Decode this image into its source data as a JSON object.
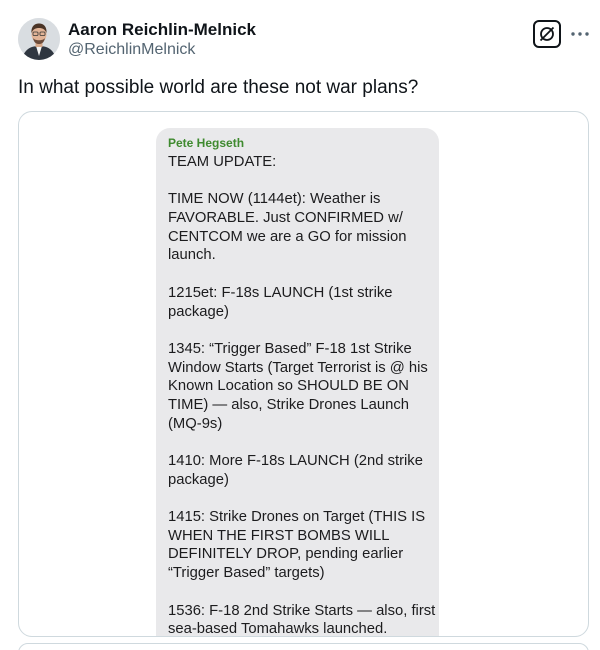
{
  "author": {
    "name": "Aaron Reichlin-Melnick",
    "handle": "@ReichlinMelnick"
  },
  "icons": {
    "grok": "grok-icon",
    "more": "more-horizontal-icon",
    "avatar": "profile-photo"
  },
  "tweet": {
    "text": "In what possible world are these not war plans?"
  },
  "message": {
    "sender": "Pete Hegseth",
    "lines": [
      "TEAM UPDATE:",
      "",
      "TIME NOW (1144et): Weather is",
      "FAVORABLE. Just CONFIRMED w/",
      "CENTCOM we are a GO for mission",
      "launch.",
      "",
      "1215et: F-18s LAUNCH (1st strike",
      "package)",
      "",
      "1345: “Trigger Based” F-18 1st Strike",
      "Window Starts (Target Terrorist is @ his",
      "Known Location so SHOULD BE ON",
      "TIME) — also, Strike Drones Launch",
      "(MQ-9s)",
      "",
      "1410: More F-18s LAUNCH (2nd strike",
      "package)",
      "",
      "1415: Strike Drones on Target (THIS IS",
      "WHEN THE FIRST BOMBS WILL",
      "DEFINITELY DROP, pending earlier",
      "“Trigger Based” targets)",
      "",
      "1536: F-18 2nd Strike Starts — also, first",
      "sea-based Tomahawks launched."
    ]
  },
  "colors": {
    "text": "#0f1419",
    "secondary": "#536471",
    "border": "#cfd9de",
    "bubble": "#e9e9eb",
    "sender": "#3f8a2f"
  }
}
